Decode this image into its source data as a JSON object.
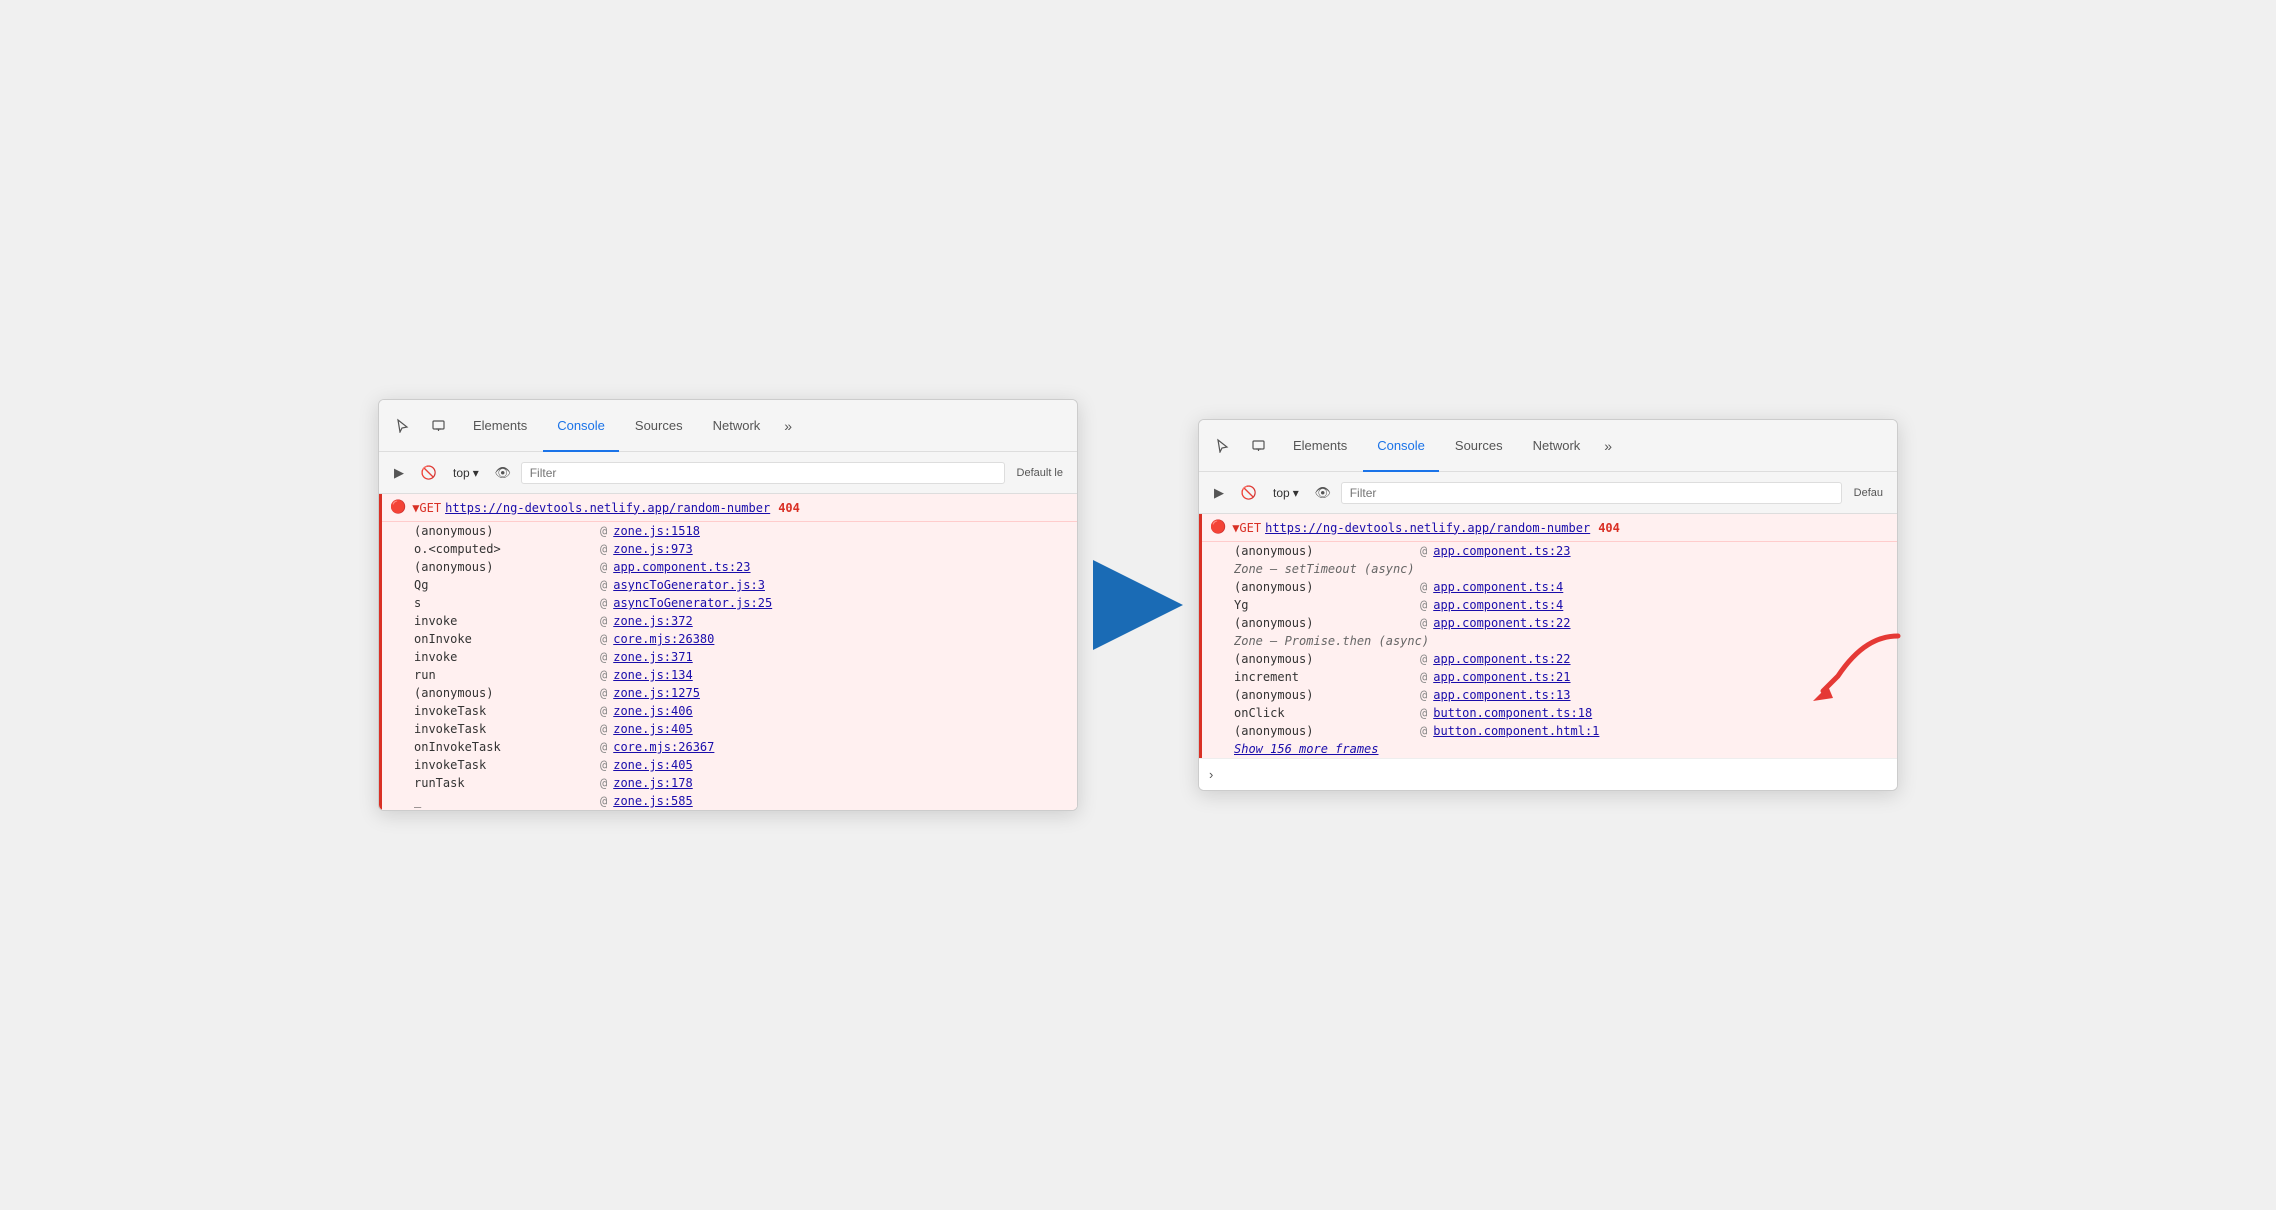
{
  "left_panel": {
    "tabs": [
      {
        "label": "Elements",
        "active": false
      },
      {
        "label": "Console",
        "active": true
      },
      {
        "label": "Sources",
        "active": false
      },
      {
        "label": "Network",
        "active": false
      },
      {
        "label": "»",
        "active": false
      }
    ],
    "toolbar": {
      "top_label": "top",
      "filter_placeholder": "Filter",
      "default_levels": "Default le"
    },
    "error": {
      "prefix": "▼GET",
      "url": "https://ng-devtools.netlify.app/random-number",
      "code": "404"
    },
    "stack_frames": [
      {
        "func": "(anonymous)",
        "at": "@",
        "link": "zone.js:1518"
      },
      {
        "func": "o.<computed>",
        "at": "@",
        "link": "zone.js:973"
      },
      {
        "func": "(anonymous)",
        "at": "@",
        "link": "app.component.ts:23"
      },
      {
        "func": "Qg",
        "at": "@",
        "link": "asyncToGenerator.js:3"
      },
      {
        "func": "s",
        "at": "@",
        "link": "asyncToGenerator.js:25"
      },
      {
        "func": "invoke",
        "at": "@",
        "link": "zone.js:372"
      },
      {
        "func": "onInvoke",
        "at": "@",
        "link": "core.mjs:26380"
      },
      {
        "func": "invoke",
        "at": "@",
        "link": "zone.js:371"
      },
      {
        "func": "run",
        "at": "@",
        "link": "zone.js:134"
      },
      {
        "func": "(anonymous)",
        "at": "@",
        "link": "zone.js:1275"
      },
      {
        "func": "invokeTask",
        "at": "@",
        "link": "zone.js:406"
      },
      {
        "func": "invokeTask",
        "at": "@",
        "link": "zone.js:405"
      },
      {
        "func": "onInvokeTask",
        "at": "@",
        "link": "core.mjs:26367"
      },
      {
        "func": "invokeTask",
        "at": "@",
        "link": "zone.js:405"
      },
      {
        "func": "runTask",
        "at": "@",
        "link": "zone.js:178"
      },
      {
        "func": "_",
        "at": "@",
        "link": "zone.js:585"
      }
    ]
  },
  "right_panel": {
    "tabs": [
      {
        "label": "Elements",
        "active": false
      },
      {
        "label": "Console",
        "active": true
      },
      {
        "label": "Sources",
        "active": false
      },
      {
        "label": "Network",
        "active": false
      },
      {
        "label": "»",
        "active": false
      }
    ],
    "toolbar": {
      "top_label": "top",
      "filter_placeholder": "Filter",
      "default_levels": "Defau"
    },
    "error": {
      "prefix": "▼GET",
      "url": "https://ng-devtools.netlify.app/random-number",
      "code": "404"
    },
    "stack_frames": [
      {
        "func": "(anonymous)",
        "at": "@",
        "link": "app.component.ts:23",
        "italic_before": null
      },
      {
        "func": "Zone — setTimeout (async)",
        "italic": true
      },
      {
        "func": "(anonymous)",
        "at": "@",
        "link": "app.component.ts:4"
      },
      {
        "func": "Yg",
        "at": "@",
        "link": "app.component.ts:4"
      },
      {
        "func": "(anonymous)",
        "at": "@",
        "link": "app.component.ts:22"
      },
      {
        "func": "Zone — Promise.then (async)",
        "italic": true
      },
      {
        "func": "(anonymous)",
        "at": "@",
        "link": "app.component.ts:22"
      },
      {
        "func": "increment",
        "at": "@",
        "link": "app.component.ts:21"
      },
      {
        "func": "(anonymous)",
        "at": "@",
        "link": "app.component.ts:13"
      },
      {
        "func": "onClick",
        "at": "@",
        "link": "button.component.ts:18"
      },
      {
        "func": "(anonymous)",
        "at": "@",
        "link": "button.component.html:1"
      }
    ],
    "show_more": "Show 156 more frames"
  }
}
